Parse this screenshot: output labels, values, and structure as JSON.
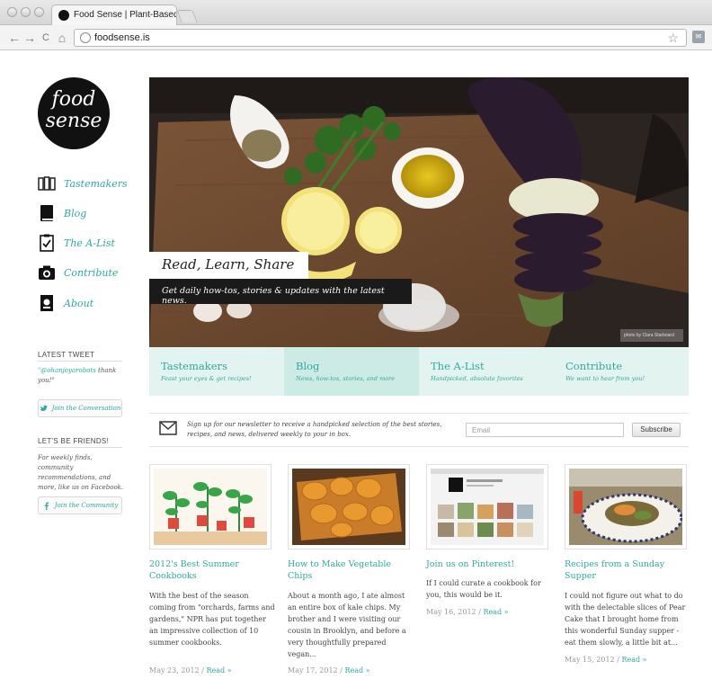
{
  "browser": {
    "tab_title": "Food Sense | Plant-Based Ea",
    "url": "foodsense.is",
    "nav": {
      "back": "←",
      "forward": "→",
      "reload": "C",
      "home": "⌂"
    }
  },
  "logo": {
    "line1": "food",
    "line2": "sense"
  },
  "sidebar": {
    "nav": [
      {
        "label": "Tastemakers",
        "icon": "tastemakers-icon"
      },
      {
        "label": "Blog",
        "icon": "book-icon"
      },
      {
        "label": "The A-List",
        "icon": "clipboard-check-icon"
      },
      {
        "label": "Contribute",
        "icon": "camera-icon"
      },
      {
        "label": "About",
        "icon": "about-icon"
      }
    ],
    "latest_tweet": {
      "heading": "LATEST TWEET",
      "handle": "\"@ohanjoyarobots",
      "text": " thank you!\"",
      "button": "Join the Conversation"
    },
    "friends": {
      "heading": "LET'S BE FRIENDS!",
      "text": "For weekly finds, community recommendations, and more, like us on Facebook.",
      "button": "Join the Community"
    }
  },
  "hero": {
    "title": "Read, Learn, Share",
    "subtitle": "Get daily how-tos, stories & updates with the latest news.",
    "credit": "photo by Clara Starboard"
  },
  "categories": [
    {
      "title": "Tastemakers",
      "subtitle": "Feast your eyes & get recipes!"
    },
    {
      "title": "Blog",
      "subtitle": "News, how-tos, stories, and more"
    },
    {
      "title": "The A-List",
      "subtitle": "Handpicked, absolute favorites"
    },
    {
      "title": "Contribute",
      "subtitle": "We want to hear from you!"
    }
  ],
  "newsletter": {
    "text": "Sign up for our newsletter to receive a handpicked selection of the best stories, recipes, and news, delivered weekly to your in box.",
    "placeholder": "Email",
    "button": "Subscribe"
  },
  "posts": [
    {
      "title": "2012's Best Summer Cookbooks",
      "excerpt": "With the best of the season coming from \"orchards, farms and gardens,\" NPR has put together an impressive collection of 10 summer cookbooks.",
      "date": "May 23, 2012",
      "read": "Read »"
    },
    {
      "title": "How to Make Vegetable Chips",
      "excerpt": "About a month ago, I ate almost an entire box of kale chips. My brother and I were visiting our cousin in Brooklyn, and before a very thoughtfully prepared vegan...",
      "date": "May 17, 2012",
      "read": "Read »"
    },
    {
      "title": "Join us on Pinterest!",
      "excerpt": "If I could curate a cookbook for you, this would be it.",
      "date": "May 16, 2012",
      "read": "Read »"
    },
    {
      "title": "Recipes from a Sunday Supper",
      "excerpt": "I could not figure out what to do with the delectable slices of Pear Cake that I brought home from this wonderful Sunday supper - eat them slowly, a little bit at...",
      "date": "May 15, 2012",
      "read": "Read »"
    }
  ],
  "colors": {
    "accent": "#2fa9a0",
    "tab_bg": "#e3f3f0",
    "tab_active_bg": "#cdebe5"
  }
}
